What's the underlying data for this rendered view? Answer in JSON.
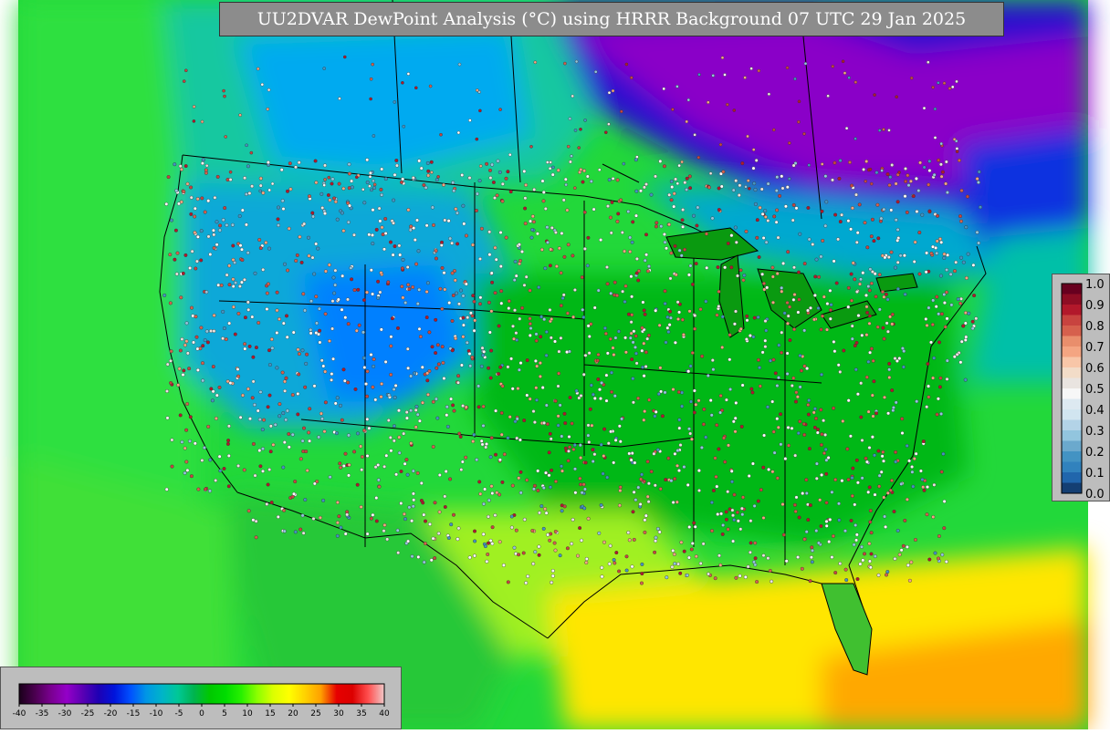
{
  "title": "UU2DVAR DewPoint Analysis (°C) using HRRR Background 07 UTC 29 Jan 2025",
  "colorbars": {
    "observation_weight": {
      "ticks": [
        "1.0",
        "0.9",
        "0.8",
        "0.7",
        "0.6",
        "0.5",
        "0.4",
        "0.3",
        "0.2",
        "0.1",
        "0.0"
      ],
      "colors": [
        "#67001f",
        "#8e0d24",
        "#b2182b",
        "#c8433f",
        "#d6604d",
        "#e98e6c",
        "#f4a582",
        "#f8c6a8",
        "#f2dcc8",
        "#e9e4e0",
        "#f7f7f7",
        "#dde9f1",
        "#d1e5f0",
        "#b3d3e7",
        "#92c5de",
        "#6ba9cd",
        "#4393c3",
        "#3182bd",
        "#2166ac",
        "#143f73"
      ]
    },
    "dewpoint": {
      "unit": "°C",
      "ticks": [
        "-40",
        "-35",
        "-30",
        "-25",
        "-20",
        "-15",
        "-10",
        "-5",
        "0",
        "5",
        "10",
        "15",
        "20",
        "25",
        "30",
        "35",
        "40"
      ],
      "colors": [
        "#1a001a",
        "#4b0050",
        "#7a0090",
        "#9400c8",
        "#5a00b4",
        "#1e00b4",
        "#0014dc",
        "#0050ff",
        "#0096e6",
        "#00b4c8",
        "#00c896",
        "#00b450",
        "#00c800",
        "#00dc00",
        "#28f000",
        "#8cff00",
        "#dcff00",
        "#ffff00",
        "#ffd200",
        "#ffa000",
        "#e60000",
        "#dc0000",
        "#ff5050",
        "#f0c8c8"
      ]
    }
  }
}
